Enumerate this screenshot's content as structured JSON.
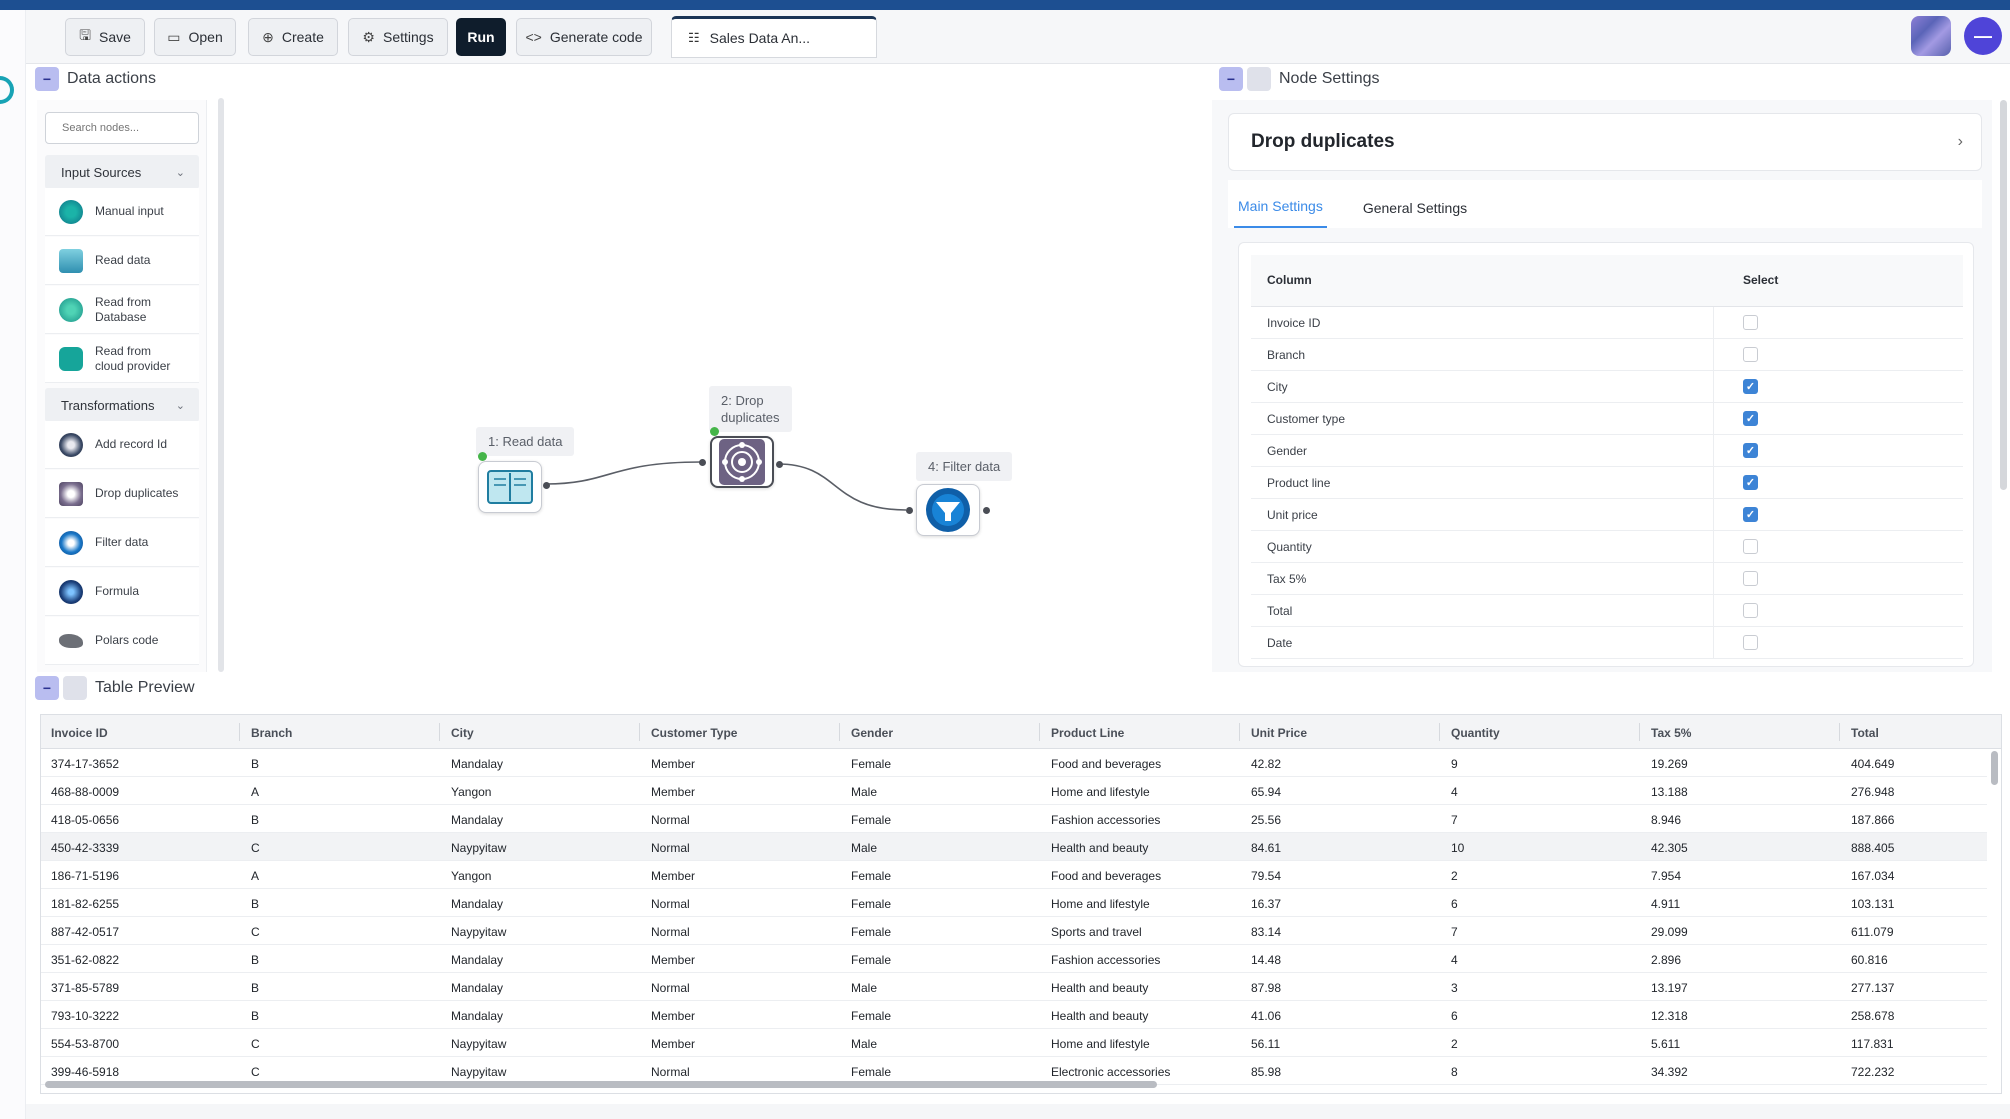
{
  "toolbar": {
    "save_label": "Save",
    "open_label": "Open",
    "create_label": "Create",
    "settings_label": "Settings",
    "run_label": "Run",
    "generate_code_label": "Generate code",
    "file_tab_label": "Sales Data An...",
    "avatar_initial": "—"
  },
  "data_actions": {
    "title": "Data actions",
    "search_placeholder": "Search nodes...",
    "groups": [
      {
        "label": "Input Sources",
        "items": [
          "Manual input",
          "Read data",
          "Read from\nDatabase",
          "Read from\ncloud provider"
        ]
      },
      {
        "label": "Transformations",
        "items": [
          "Add record Id",
          "Drop duplicates",
          "Filter data",
          "Formula",
          "Polars code"
        ]
      }
    ]
  },
  "canvas": {
    "nodes": [
      {
        "label": "1: Read data",
        "icon": "book-icon"
      },
      {
        "label": "2: Drop\nduplicates",
        "icon": "mandala-icon"
      },
      {
        "label": "4: Filter data",
        "icon": "funnel-icon"
      }
    ]
  },
  "node_settings": {
    "title": "Node Settings",
    "node_name": "Drop duplicates",
    "tabs": [
      "Main Settings",
      "General Settings"
    ],
    "active_tab": "Main Settings",
    "column_header": "Column",
    "select_header": "Select",
    "columns": [
      {
        "name": "Invoice ID",
        "selected": false
      },
      {
        "name": "Branch",
        "selected": false
      },
      {
        "name": "City",
        "selected": true
      },
      {
        "name": "Customer type",
        "selected": true
      },
      {
        "name": "Gender",
        "selected": true
      },
      {
        "name": "Product line",
        "selected": true
      },
      {
        "name": "Unit price",
        "selected": true
      },
      {
        "name": "Quantity",
        "selected": false
      },
      {
        "name": "Tax 5%",
        "selected": false
      },
      {
        "name": "Total",
        "selected": false
      },
      {
        "name": "Date",
        "selected": false
      }
    ]
  },
  "table_preview": {
    "title": "Table Preview",
    "headers": [
      "Invoice ID",
      "Branch",
      "City",
      "Customer Type",
      "Gender",
      "Product Line",
      "Unit Price",
      "Quantity",
      "Tax 5%",
      "Total"
    ],
    "rows": [
      [
        "374-17-3652",
        "B",
        "Mandalay",
        "Member",
        "Female",
        "Food and beverages",
        "42.82",
        "9",
        "19.269",
        "404.649"
      ],
      [
        "468-88-0009",
        "A",
        "Yangon",
        "Member",
        "Male",
        "Home and lifestyle",
        "65.94",
        "4",
        "13.188",
        "276.948"
      ],
      [
        "418-05-0656",
        "B",
        "Mandalay",
        "Normal",
        "Female",
        "Fashion accessories",
        "25.56",
        "7",
        "8.946",
        "187.866"
      ],
      [
        "450-42-3339",
        "C",
        "Naypyitaw",
        "Normal",
        "Male",
        "Health and beauty",
        "84.61",
        "10",
        "42.305",
        "888.405"
      ],
      [
        "186-71-5196",
        "A",
        "Yangon",
        "Member",
        "Female",
        "Food and beverages",
        "79.54",
        "2",
        "7.954",
        "167.034"
      ],
      [
        "181-82-6255",
        "B",
        "Mandalay",
        "Normal",
        "Female",
        "Home and lifestyle",
        "16.37",
        "6",
        "4.911",
        "103.131"
      ],
      [
        "887-42-0517",
        "C",
        "Naypyitaw",
        "Normal",
        "Female",
        "Sports and travel",
        "83.14",
        "7",
        "29.099",
        "611.079"
      ],
      [
        "351-62-0822",
        "B",
        "Mandalay",
        "Member",
        "Female",
        "Fashion accessories",
        "14.48",
        "4",
        "2.896",
        "60.816"
      ],
      [
        "371-85-5789",
        "B",
        "Mandalay",
        "Normal",
        "Male",
        "Health and beauty",
        "87.98",
        "3",
        "13.197",
        "277.137"
      ],
      [
        "793-10-3222",
        "B",
        "Mandalay",
        "Member",
        "Female",
        "Health and beauty",
        "41.06",
        "6",
        "12.318",
        "258.678"
      ],
      [
        "554-53-8700",
        "C",
        "Naypyitaw",
        "Member",
        "Male",
        "Home and lifestyle",
        "56.11",
        "2",
        "5.611",
        "117.831"
      ],
      [
        "399-46-5918",
        "C",
        "Naypyitaw",
        "Normal",
        "Female",
        "Electronic accessories",
        "85.98",
        "8",
        "34.392",
        "722.232"
      ]
    ]
  }
}
